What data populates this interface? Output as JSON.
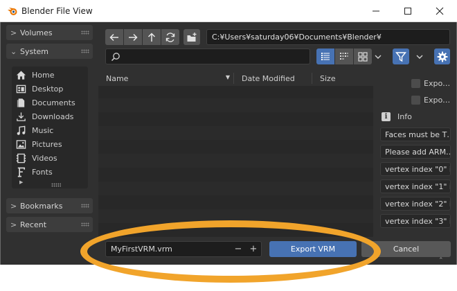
{
  "window": {
    "title": "Blender File View",
    "minimize_icon": "minimize-icon",
    "maximize_icon": "maximize-icon",
    "close_icon": "close-icon"
  },
  "sidebar": {
    "volumes": {
      "label": "Volumes",
      "expanded": false
    },
    "system": {
      "label": "System",
      "expanded": true,
      "items": [
        {
          "label": "Home",
          "icon": "home-icon"
        },
        {
          "label": "Desktop",
          "icon": "desktop-icon"
        },
        {
          "label": "Documents",
          "icon": "documents-icon"
        },
        {
          "label": "Downloads",
          "icon": "downloads-icon"
        },
        {
          "label": "Music",
          "icon": "music-icon"
        },
        {
          "label": "Pictures",
          "icon": "pictures-icon"
        },
        {
          "label": "Videos",
          "icon": "videos-icon"
        },
        {
          "label": "Fonts",
          "icon": "fonts-icon"
        }
      ]
    },
    "bookmarks": {
      "label": "Bookmarks",
      "expanded": false
    },
    "recent": {
      "label": "Recent",
      "expanded": false
    }
  },
  "toolbar": {
    "path": "C:¥Users¥saturday06¥Documents¥Blender¥",
    "search_value": "",
    "view_mode": "vertical-list"
  },
  "file_list": {
    "columns": [
      "Name",
      "Date Modified",
      "Size"
    ],
    "sort_column": "Name",
    "rows": []
  },
  "options_panel": {
    "checkboxes": [
      {
        "label": "Expo…",
        "checked": false
      },
      {
        "label": "Expo…",
        "checked": false
      }
    ],
    "info_label": "Info",
    "messages": [
      "Faces must be T…",
      "Please add ARM…",
      "vertex index \"0\" i…",
      "vertex index \"1\" i…",
      "vertex index \"2\" i…",
      "vertex index \"3\" i…"
    ]
  },
  "bottom": {
    "filename": "MyFirstVRM.vrm",
    "decrement_label": "−",
    "increment_label": "+",
    "export_label": "Export VRM",
    "cancel_label": "Cancel"
  },
  "colors": {
    "accent": "#4772b3",
    "highlight_ring": "#f1a42b",
    "background": "#303030"
  }
}
